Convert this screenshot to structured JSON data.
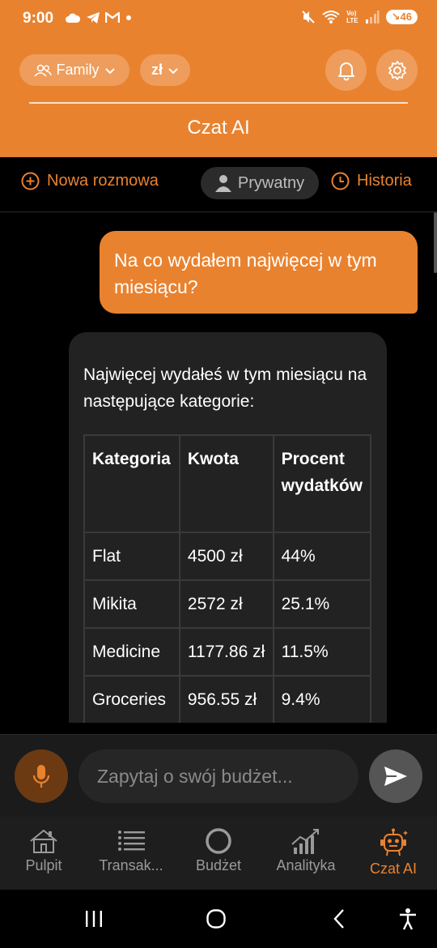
{
  "status_bar": {
    "time": "9:00",
    "lte_top": "Vo)",
    "lte_bottom": "LTE",
    "network_badge": "5",
    "battery": "46"
  },
  "header": {
    "family_label": "Family",
    "currency_label": "zł",
    "title": "Czat AI",
    "accent_color": "#E9822F"
  },
  "toolbar": {
    "new_chat_label": "Nowa rozmowa",
    "private_label": "Prywatny",
    "history_label": "Historia"
  },
  "messages": {
    "user_message": "Na co wydałem najwięcej w tym miesiącu?",
    "ai_intro": "Najwięcej wydałeś w tym miesiącu na następujące kategorie:",
    "table": {
      "headers": [
        "Kategoria",
        "Kwota",
        "Procent wydatków"
      ],
      "rows": [
        [
          "Flat",
          "4500 zł",
          "44%"
        ],
        [
          "Mikita",
          "2572 zł",
          "25.1%"
        ],
        [
          "Medicine",
          "1177.86 zł",
          "11.5%"
        ],
        [
          "Groceries",
          "956.55 zł",
          "9.4%"
        ]
      ]
    }
  },
  "input": {
    "placeholder": "Zapytaj o swój budżet..."
  },
  "nav": {
    "items": [
      {
        "label": "Pulpit",
        "icon": "house-icon"
      },
      {
        "label": "Transak...",
        "icon": "list-icon"
      },
      {
        "label": "Budżet",
        "icon": "ring-icon"
      },
      {
        "label": "Analityka",
        "icon": "chart-icon"
      },
      {
        "label": "Czat AI",
        "icon": "robot-icon"
      }
    ],
    "active_index": 4
  }
}
